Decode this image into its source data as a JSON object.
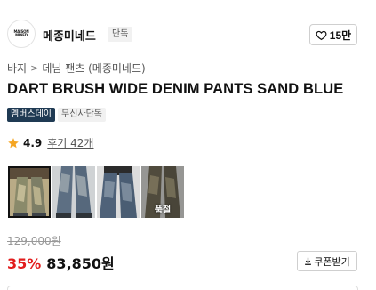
{
  "brand": {
    "logo_text": "MAISON MINED",
    "name": "메종미네드",
    "exclusive_tag": "단독"
  },
  "like": {
    "icon": "heart-outline-icon",
    "count": "15만"
  },
  "breadcrumb": {
    "items": [
      "바지",
      "데님 팬츠 (메종미네드)"
    ],
    "separator": ">"
  },
  "product": {
    "title": "DART BRUSH WIDE DENIM PANTS SAND BLUE",
    "tags": [
      "멤버스데이",
      "무신사단독"
    ]
  },
  "rating": {
    "icon": "star-icon",
    "value": "4.9",
    "review_label": "후기 42개"
  },
  "thumbnails": [
    {
      "name": "thumb-1",
      "active": true
    },
    {
      "name": "thumb-2",
      "active": false
    },
    {
      "name": "thumb-3",
      "active": false
    },
    {
      "name": "thumb-4",
      "active": false,
      "overlay": "품절"
    }
  ],
  "pricing": {
    "original": "129,000원",
    "discount": "35%",
    "sale": "83,850원"
  },
  "coupon": {
    "icon": "download-icon",
    "label": "쿠폰받기"
  },
  "colors": {
    "discount_red": "#e21d1d",
    "member_tag_bg": "#1f3a53",
    "star_orange": "#f5a623"
  }
}
